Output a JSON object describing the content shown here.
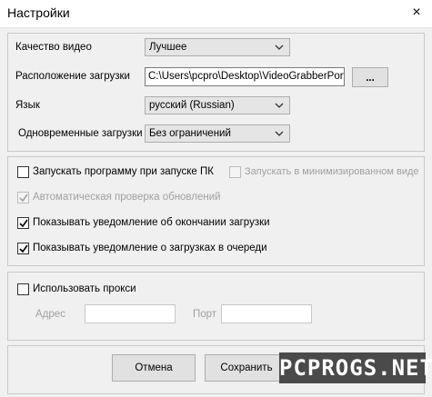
{
  "window": {
    "title": "Настройки",
    "close_icon": "×"
  },
  "video_quality": {
    "label": "Качество видео",
    "value": "Лучшее"
  },
  "download_location": {
    "label": "Расположение загрузки",
    "value": "C:\\Users\\pcpro\\Desktop\\VideoGrabberPortab",
    "browse_label": "..."
  },
  "language": {
    "label": "Язык",
    "value": "русский (Russian)"
  },
  "concurrent_downloads": {
    "label": "Одновременные загрузки",
    "value": "Без ограничений"
  },
  "options": {
    "launch_at_startup": {
      "label": "Запускать программу при запуске ПК",
      "checked": false
    },
    "start_minimized": {
      "label": "Запускать в минимизированном виде",
      "checked": false,
      "enabled": false
    },
    "auto_update": {
      "label": "Автоматическая проверка обновлений",
      "checked": true,
      "enabled": false
    },
    "notify_finished": {
      "label": "Показывать уведомление об окончании загрузки",
      "checked": true
    },
    "notify_queued": {
      "label": "Показывать уведомление о загрузках в очереди",
      "checked": true
    }
  },
  "proxy": {
    "use_label": "Использовать прокси",
    "checked": false,
    "address_label": "Адрес",
    "port_label": "Порт",
    "address_value": "",
    "port_value": ""
  },
  "buttons": {
    "cancel": "Отмена",
    "save": "Сохранить"
  },
  "watermark": "PCPROGS.NET"
}
